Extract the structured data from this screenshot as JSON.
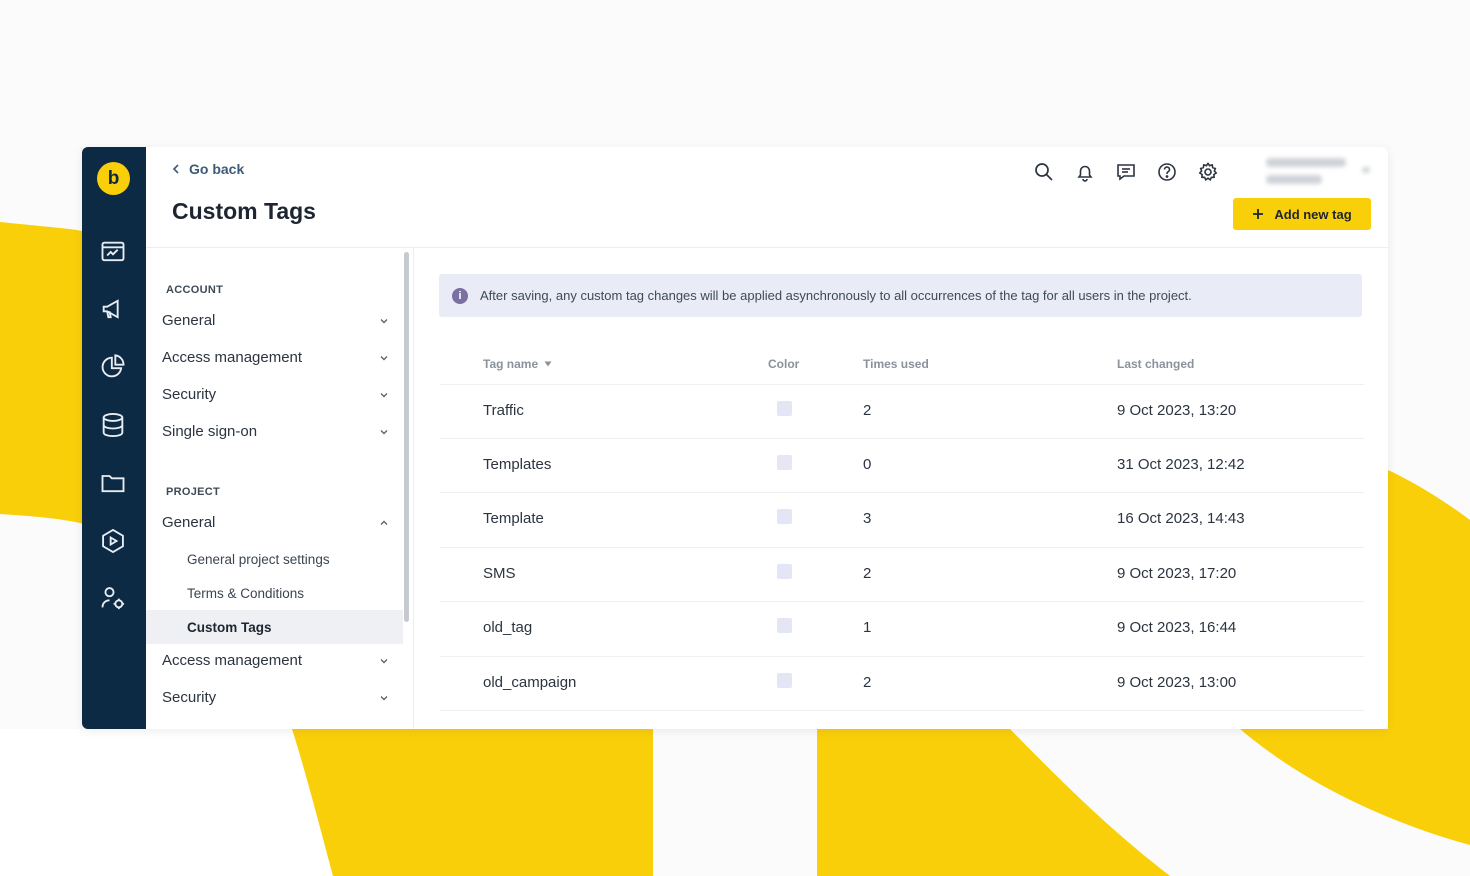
{
  "colors": {
    "brand_yellow": "#f9cf0a",
    "rail_navy": "#0d2a45",
    "notice_bg": "#e9ebf6",
    "info_purple": "#7c6fa2"
  },
  "rail": {
    "logo_letter": "b",
    "icons": [
      "dashboard-icon",
      "megaphone-icon",
      "pie-chart-icon",
      "database-icon",
      "folder-icon",
      "play-icon",
      "user-settings-icon"
    ]
  },
  "header": {
    "go_back": "Go back",
    "title": "Custom Tags",
    "icons": [
      "search-icon",
      "bell-icon",
      "chat-icon",
      "help-icon",
      "gear-icon"
    ],
    "add_button": "Add new tag",
    "add_icon": "plus-icon"
  },
  "sidebar": {
    "account_label": "ACCOUNT",
    "account_items": [
      "General",
      "Access management",
      "Security",
      "Single sign-on"
    ],
    "project_label": "PROJECT",
    "project_general": "General",
    "project_subitems": [
      "General project settings",
      "Terms & Conditions",
      "Custom Tags"
    ],
    "active_subitem": "Custom Tags",
    "project_items": [
      "Access management",
      "Security"
    ]
  },
  "notice": {
    "text": "After saving, any custom tag changes will be applied asynchronously to all occurrences of the tag for all users in the project."
  },
  "table": {
    "headers": {
      "tag_name": "Tag name",
      "color": "Color",
      "times_used": "Times used",
      "last_changed": "Last changed"
    },
    "sort_column": "Tag name",
    "rows": [
      {
        "name": "Traffic",
        "color": "#e4e6f6",
        "times_used": "2",
        "last_changed": "9 Oct 2023, 13:20"
      },
      {
        "name": "Templates",
        "color": "#e8e6f5",
        "times_used": "0",
        "last_changed": "31 Oct 2023, 12:42"
      },
      {
        "name": "Template",
        "color": "#e4e6f6",
        "times_used": "3",
        "last_changed": "16 Oct 2023, 14:43"
      },
      {
        "name": "SMS",
        "color": "#e4e6f6",
        "times_used": "2",
        "last_changed": "9 Oct 2023, 17:20"
      },
      {
        "name": "old_tag",
        "color": "#e4e6f6",
        "times_used": "1",
        "last_changed": "9 Oct 2023, 16:44"
      },
      {
        "name": "old_campaign",
        "color": "#e4e6f6",
        "times_used": "2",
        "last_changed": "9 Oct 2023, 13:00"
      }
    ]
  }
}
